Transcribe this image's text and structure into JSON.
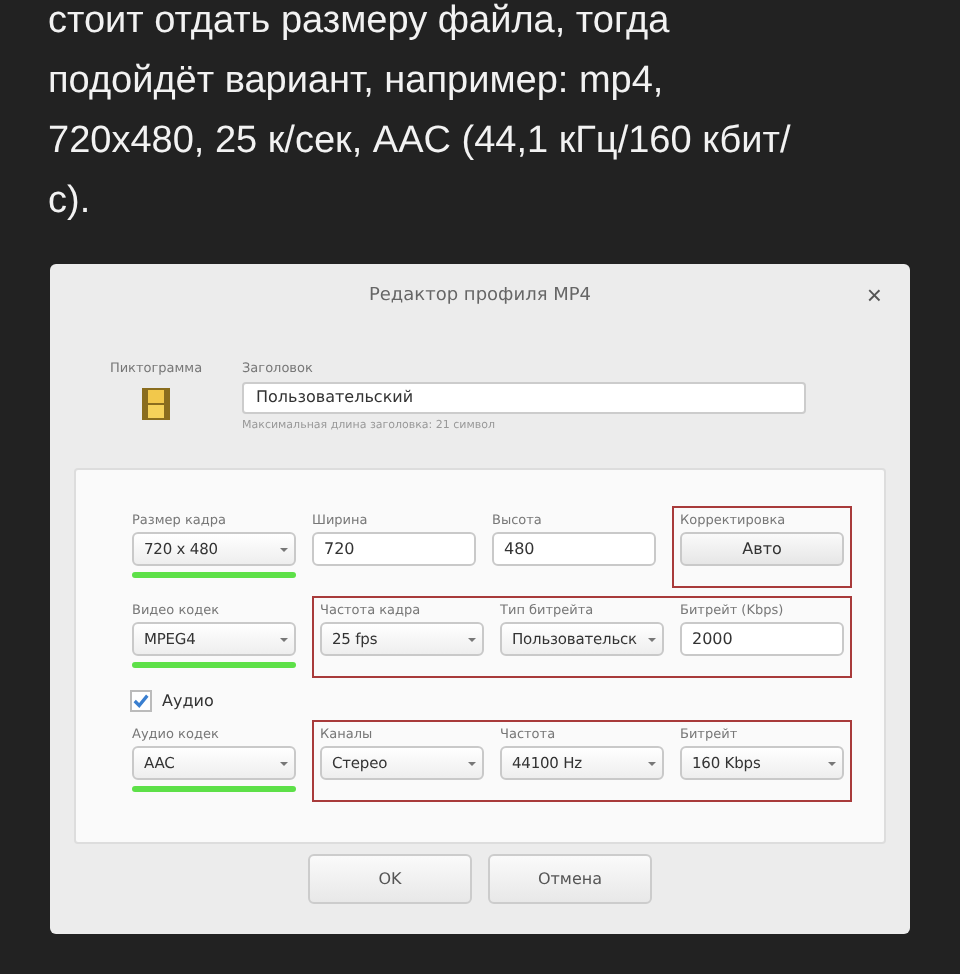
{
  "article": {
    "lines": [
      "стоит отдать размеру файла, тогда",
      "подойдёт вариант, например: mp4,",
      "720x480, 25 к/сек, AAC (44,1 кГц/160 кбит/",
      "с)."
    ]
  },
  "dialog": {
    "title": "Редактор профиля MP4",
    "close": "×",
    "icon_label": "Пиктограмма",
    "title_field": {
      "label": "Заголовок",
      "value": "Пользовательский",
      "hint": "Максимальная длина заголовка: 21 символ"
    },
    "video_rows": [
      {
        "groups": [
          {
            "highlighted": false,
            "fields": [
              {
                "kind": "select",
                "label": "Размер кадра",
                "value": "720 x 480",
                "underlined": true
              },
              {
                "kind": "input",
                "label": "Ширина",
                "value": "720",
                "underlined": false
              },
              {
                "kind": "input",
                "label": "Высота",
                "value": "480",
                "underlined": false
              }
            ]
          },
          {
            "highlighted": true,
            "fields": [
              {
                "kind": "button",
                "label": "Корректировка",
                "value": "Авто",
                "underlined": false
              }
            ]
          }
        ]
      },
      {
        "groups": [
          {
            "highlighted": false,
            "fields": [
              {
                "kind": "select",
                "label": "Видео кодек",
                "value": "MPEG4",
                "underlined": true
              }
            ]
          },
          {
            "highlighted": true,
            "fields": [
              {
                "kind": "select",
                "label": "Частота кадра",
                "value": "25 fps",
                "underlined": false
              },
              {
                "kind": "select",
                "label": "Тип битрейта",
                "value": "Пользовательск",
                "underlined": false
              },
              {
                "kind": "input",
                "label": "Битрейт (Kbps)",
                "value": "2000",
                "underlined": false
              }
            ]
          }
        ]
      }
    ],
    "audio": {
      "label": "Аудио",
      "checked": true
    },
    "audio_rows": [
      {
        "groups": [
          {
            "highlighted": false,
            "fields": [
              {
                "kind": "select",
                "label": "Аудио кодек",
                "value": "AAC",
                "underlined": true
              }
            ]
          },
          {
            "highlighted": true,
            "fields": [
              {
                "kind": "select",
                "label": "Каналы",
                "value": "Стерео",
                "underlined": false
              },
              {
                "kind": "select",
                "label": "Частота",
                "value": "44100 Hz",
                "underlined": false
              },
              {
                "kind": "select",
                "label": "Битрейт",
                "value": "160 Kbps",
                "underlined": false
              }
            ]
          }
        ]
      }
    ],
    "buttons": [
      "OK",
      "Отмена"
    ]
  }
}
